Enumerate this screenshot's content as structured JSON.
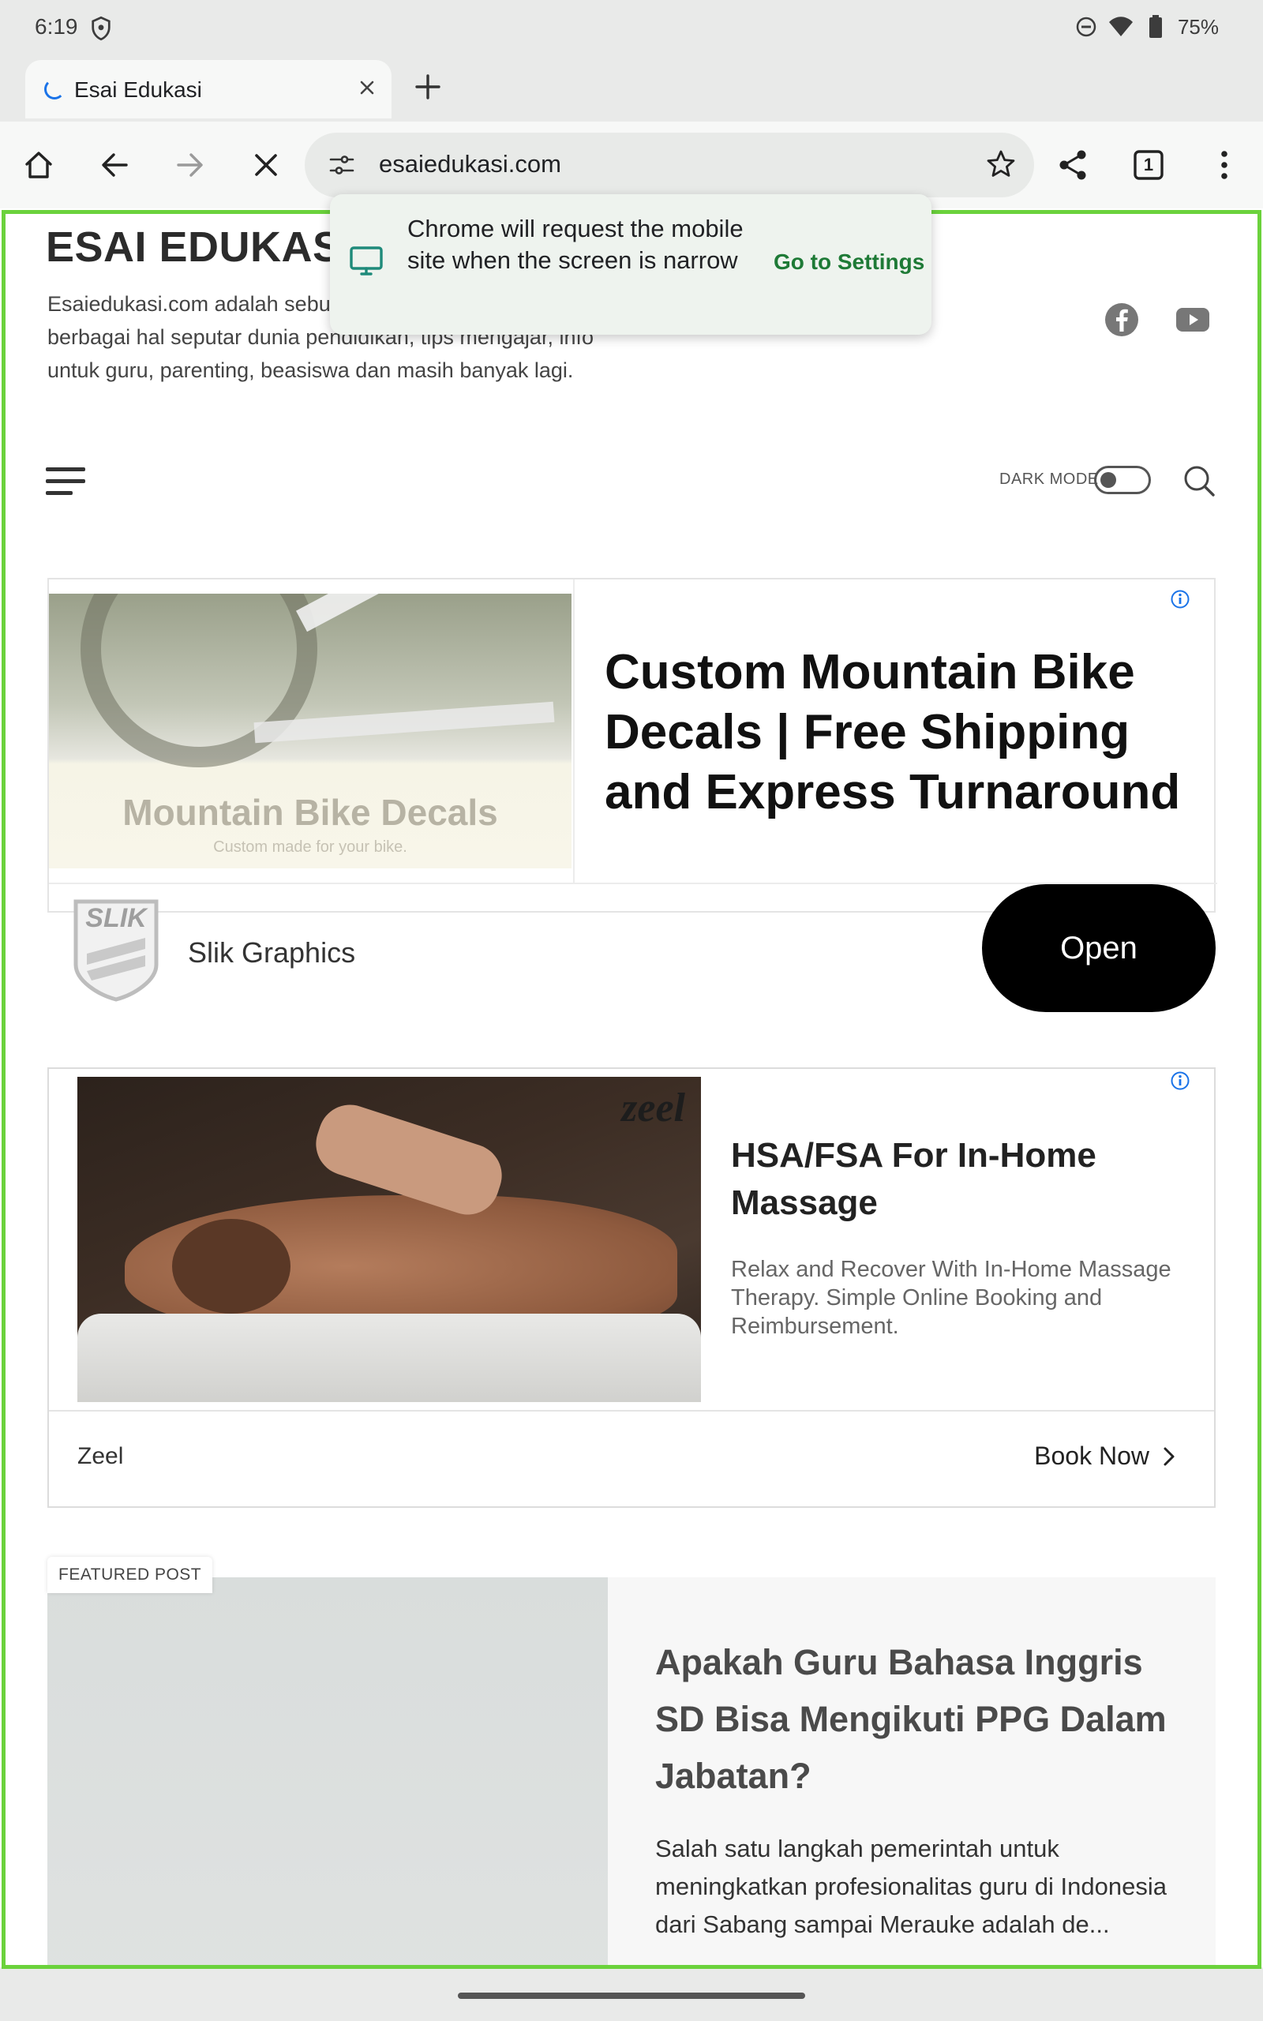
{
  "status_bar": {
    "time": "6:19",
    "battery": "75%"
  },
  "tab": {
    "title": "Esai Edukasi"
  },
  "toolbar": {
    "url": "esaiedukasi.com",
    "tab_count": "1"
  },
  "popup": {
    "message": "Chrome will request the mobile site when the screen is narrow",
    "action": "Go to Settings"
  },
  "site": {
    "title": "ESAI EDUKASI",
    "description": "Esaiedukasi.com adalah sebuah blog yang membahas berbagai hal seputar dunia pendidikan, tips mengajar, info untuk guru, parenting, beasiswa dan masih banyak lagi.",
    "dark_mode_label": "DARK MODE"
  },
  "ad1": {
    "image_title": "Mountain Bike Decals",
    "image_subtitle": "Custom made for your bike.",
    "headline": "Custom Mountain Bike Decals | Free Shipping and Express Turnaround",
    "logo_text": "SLIK",
    "advertiser": "Slik Graphics",
    "cta": "Open"
  },
  "ad2": {
    "logo_text": "zeel",
    "headline": "HSA/FSA For In-Home Massage",
    "description": "Relax and Recover With In-Home Massage Therapy. Simple Online Booking and Reimbursement.",
    "advertiser": "Zeel",
    "cta": "Book Now"
  },
  "featured": {
    "tag": "FEATURED POST",
    "title": "Apakah Guru Bahasa Inggris SD Bisa Mengikuti PPG Dalam Jabatan?",
    "excerpt": "Salah satu langkah pemerintah untuk meningkatkan profesionalitas guru di Indonesia dari Sabang sampai Merauke adalah de..."
  },
  "colors": {
    "frame_highlight": "#6bd23c",
    "popup_action": "#1e7a36",
    "info_icon": "#1a73e8"
  }
}
